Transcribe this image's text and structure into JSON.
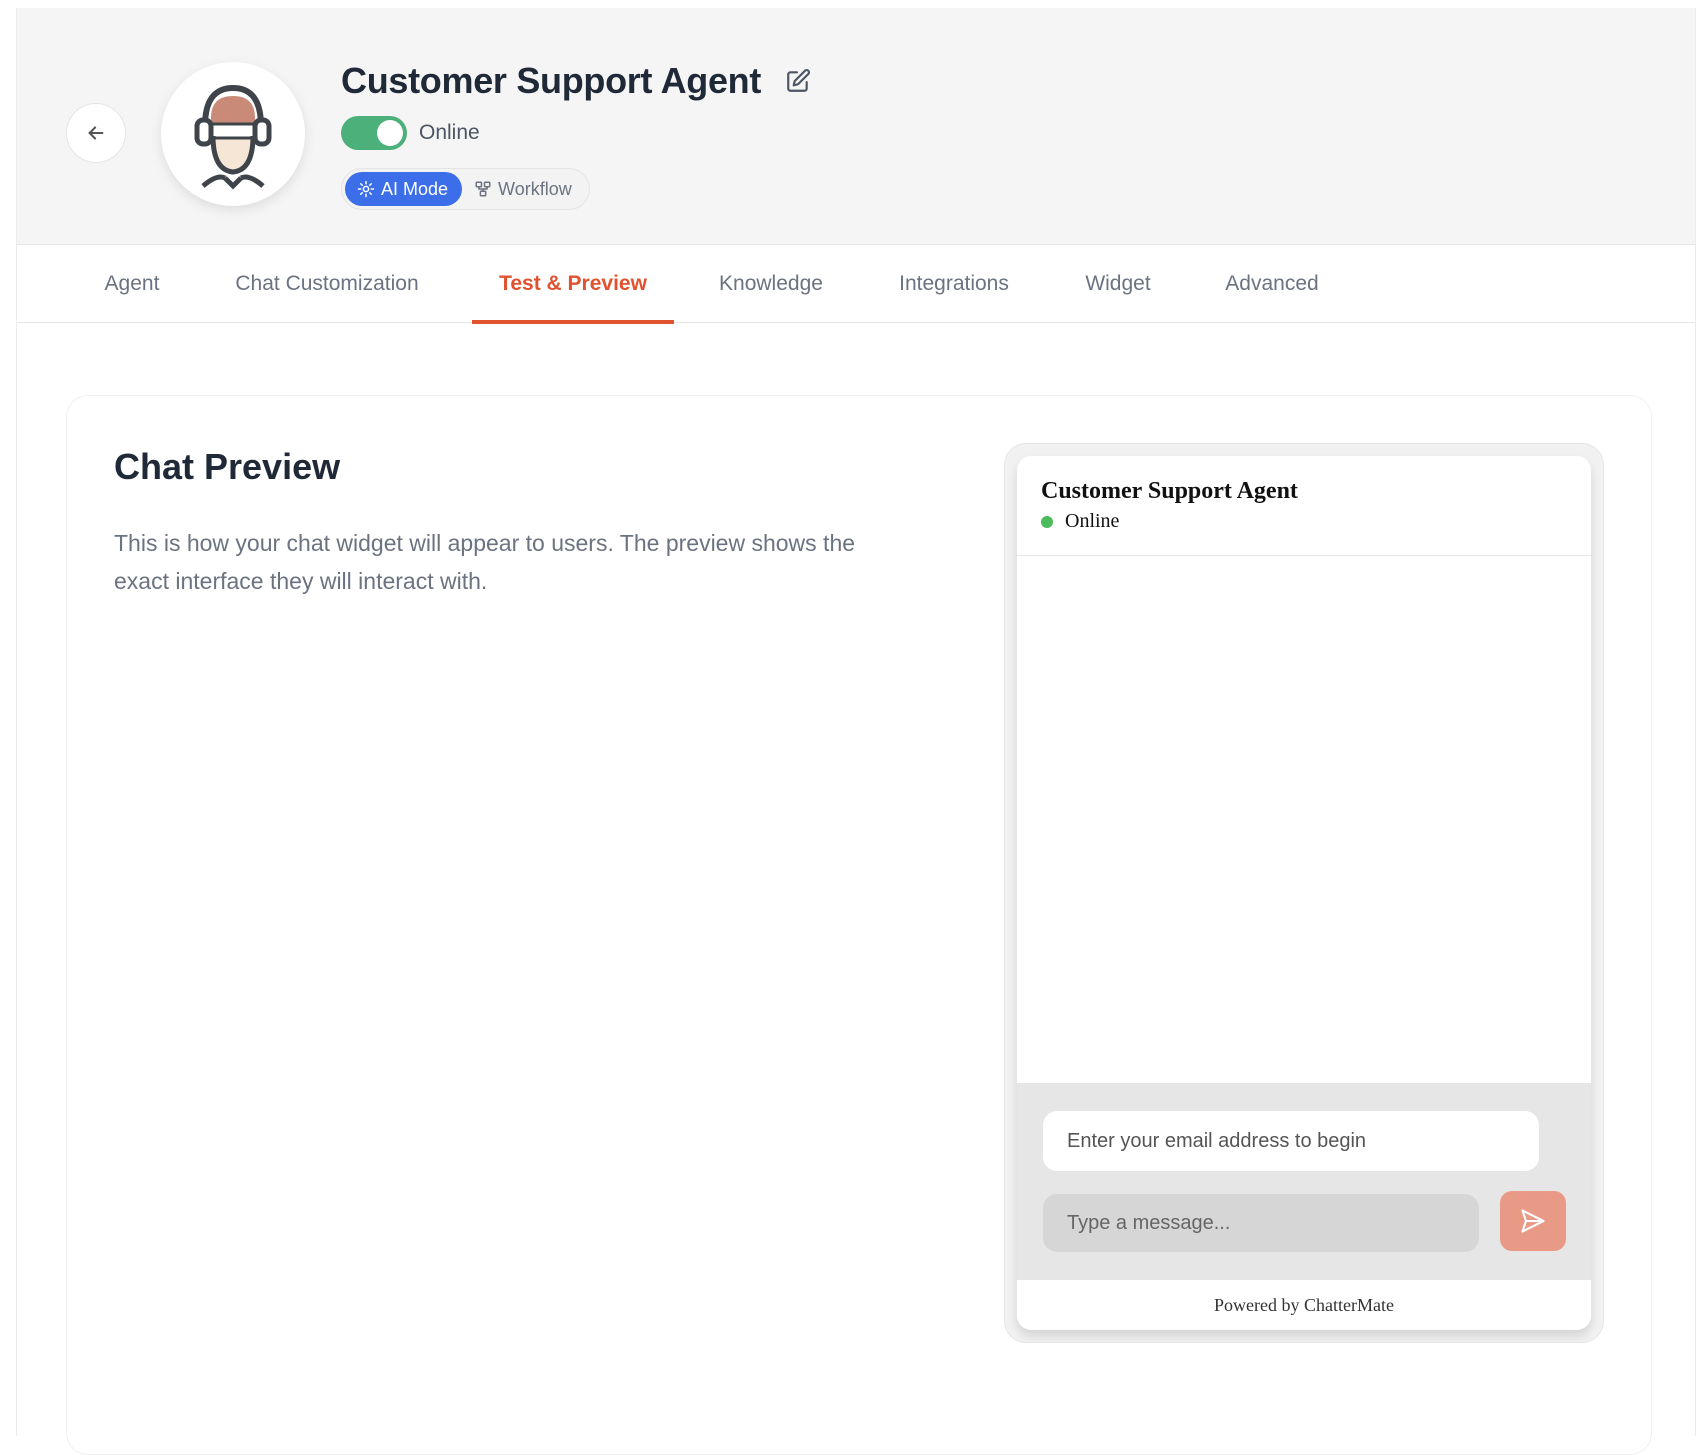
{
  "header": {
    "agent_name": "Customer Support Agent",
    "status_label": "Online",
    "status_on": true,
    "modes": [
      {
        "label": "AI Mode",
        "icon": "sparkle-icon",
        "active": true
      },
      {
        "label": "Workflow",
        "icon": "workflow-icon",
        "active": false
      }
    ]
  },
  "tabs": [
    {
      "label": "Agent",
      "active": false
    },
    {
      "label": "Chat Customization",
      "active": false
    },
    {
      "label": "Test & Preview",
      "active": true
    },
    {
      "label": "Knowledge",
      "active": false
    },
    {
      "label": "Integrations",
      "active": false
    },
    {
      "label": "Widget",
      "active": false
    },
    {
      "label": "Advanced",
      "active": false
    }
  ],
  "preview": {
    "title": "Chat Preview",
    "description": "This is how your chat widget will appear to users. The preview shows the exact interface they will interact with."
  },
  "widget": {
    "agent_name": "Customer Support Agent",
    "status": "Online",
    "email_placeholder": "Enter your email address to begin",
    "message_placeholder": "Type a message...",
    "footer": "Powered by ChatterMate"
  },
  "colors": {
    "accent": "#e0532e",
    "toggle_on": "#4cb07b",
    "ai_mode": "#3b6ee8",
    "send_button": "#e89a86",
    "online_dot": "#4cbb5c"
  }
}
